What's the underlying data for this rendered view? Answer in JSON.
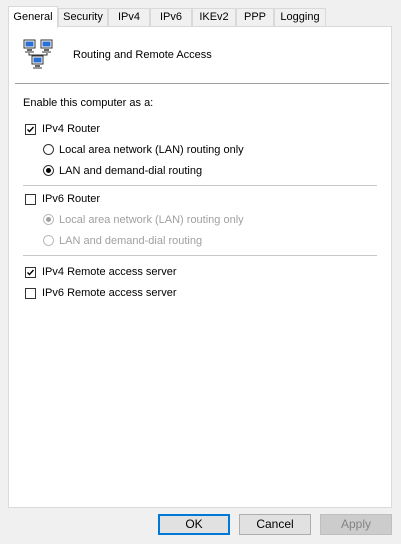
{
  "tabs": [
    "General",
    "Security",
    "IPv4",
    "IPv6",
    "IKEv2",
    "PPP",
    "Logging"
  ],
  "header": {
    "title": "Routing and Remote Access",
    "icon": "network-computers-icon"
  },
  "section_label": "Enable this computer as a:",
  "ipv4_router": {
    "label": "IPv4 Router",
    "checked": true,
    "options": [
      "Local area network (LAN) routing only",
      "LAN and demand-dial routing"
    ],
    "selected": 1
  },
  "ipv6_router": {
    "label": "IPv6 Router",
    "checked": false,
    "options": [
      "Local area network (LAN) routing only",
      "LAN and demand-dial routing"
    ],
    "selected": 0,
    "disabled": true
  },
  "ipv4_remote": {
    "label": "IPv4 Remote access server",
    "checked": true
  },
  "ipv6_remote": {
    "label": "IPv6 Remote access server",
    "checked": false
  },
  "buttons": {
    "ok": "OK",
    "cancel": "Cancel",
    "apply": "Apply"
  }
}
